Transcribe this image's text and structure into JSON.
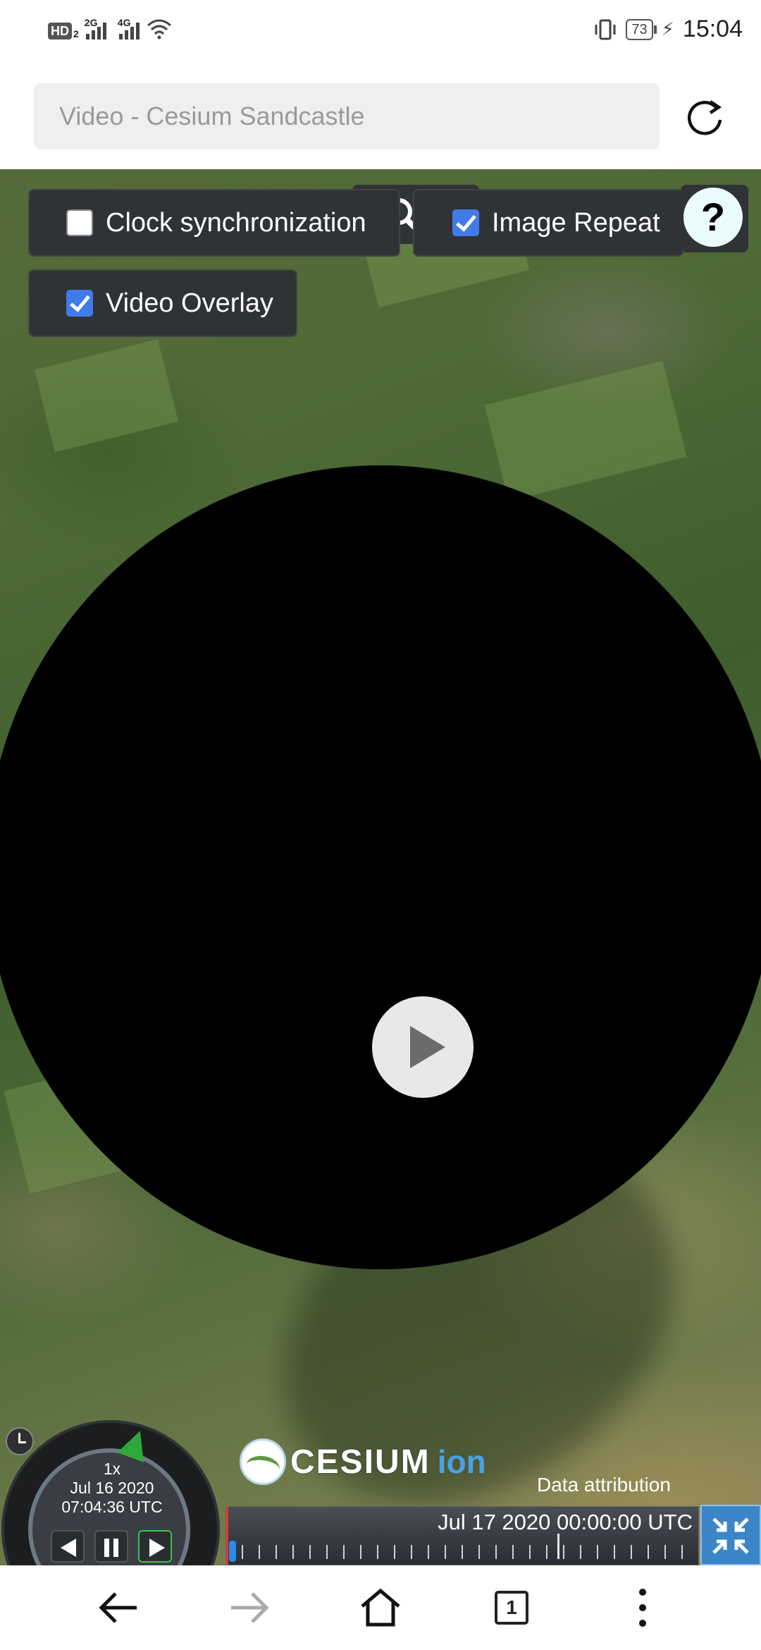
{
  "status_bar": {
    "network_badge": "HD",
    "network_badge_sub": "2",
    "sim1_label": "2G",
    "sim2_label": "4G",
    "battery_level": "73",
    "time": "15:04",
    "icons": [
      "vibrate-icon",
      "battery-icon",
      "charging-icon",
      "wifi-icon",
      "signal-icon"
    ]
  },
  "browser": {
    "url_placeholder": "Video - Cesium Sandcastle",
    "reload_icon": "reload-icon"
  },
  "toolbar": {
    "clock_sync": {
      "label": "Clock synchronization",
      "checked": false
    },
    "image_repeat": {
      "label": "Image Repeat",
      "checked": true
    },
    "video_overlay": {
      "label": "Video Overlay",
      "checked": true
    },
    "help_label": "?"
  },
  "animation": {
    "speed": "1x",
    "date": "Jul 16 2020",
    "time": "07:04:36 UTC"
  },
  "timeline": {
    "end_label": "Jul 17 2020 00:00:00 UTC"
  },
  "credits": {
    "logo_main": "CESIUM",
    "logo_sub": "ion",
    "attribution": "Data attribution"
  },
  "nav": {
    "tab_count": "1"
  },
  "colors": {
    "widget_bg": "#303336",
    "checkbox_accent": "#3f7be9",
    "fullscreen_bg": "#3b85c9",
    "needle": "#2ea83a"
  }
}
